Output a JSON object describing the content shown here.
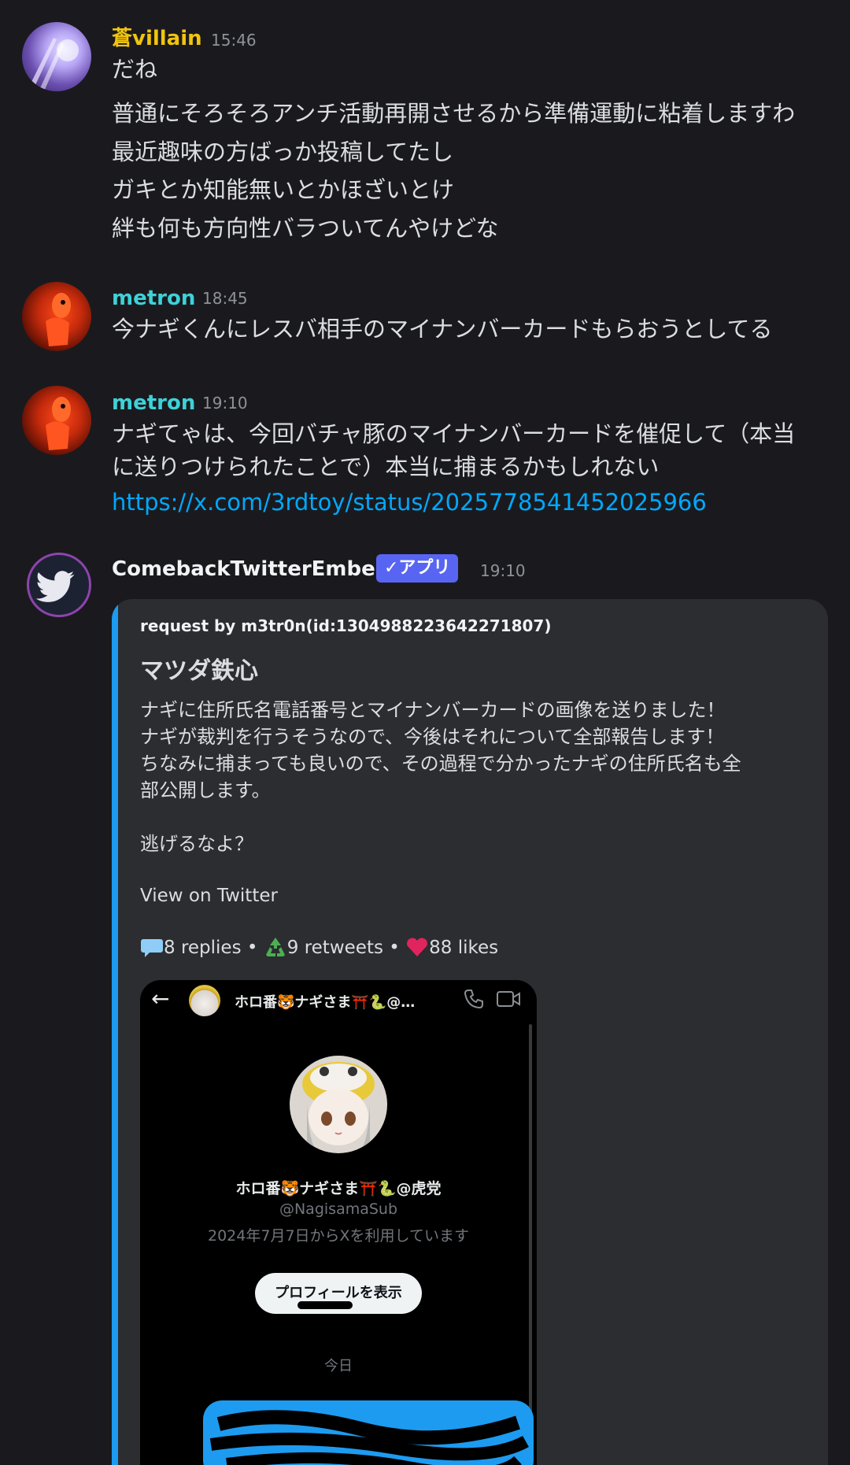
{
  "messages": [
    {
      "author": "蒼villain",
      "time": "15:46",
      "lines": [
        "だね",
        "普通にそろそろアンチ活動再開させるから準備運動に粘着しますわ",
        "最近趣味の方ばっか投稿してたし",
        "ガキとか知能無いとかほざいとけ",
        "絆も何も方向性バラついてんやけどな"
      ]
    },
    {
      "author": "metron",
      "time": "18:45",
      "lines": [
        "今ナギくんにレスバ相手のマイナンバーカードもらおうとしてる"
      ]
    },
    {
      "author": "metron",
      "time": "19:10",
      "lines": [
        "ナギてゃは、今回バチャ豚のマイナンバーカードを催促して（本当",
        "に送りつけられたことで）本当に捕まるかもしれない"
      ],
      "link": "https://x.com/3rdtoy/status/2025778541452025966"
    }
  ],
  "bot_message": {
    "author": "ComebackTwitterEmbed",
    "badge": "✓アプリ",
    "time": "19:10",
    "embed": {
      "request_line": "request by m3tr0n(id:1304988223642271807)",
      "title": "マツダ鉄心",
      "body_lines": [
        "ナギに住所氏名電話番号とマイナンバーカードの画像を送りました！",
        "ナギが裁判を行うそうなので、今後はそれについて全部報告します！",
        "ちなみに捕まっても良いので、その過程で分かったナギの住所氏名も全",
        "部公開します。",
        "",
        "逃げるなよ？"
      ],
      "view_link": "View on Twitter",
      "stats": {
        "replies": "8 replies",
        "retweets": "9 retweets",
        "likes": "88 likes",
        "separator": "•"
      },
      "screenshot": {
        "header_name": "ホロ番🐯ナギさま⛩️🐍@…",
        "profile_name": "ホロ番🐯ナギさま⛩️🐍@虎党",
        "handle": "@NagisamaSub",
        "joined": "2024年7月7日からXを利用しています",
        "view_profile_button": "プロフィールを表示",
        "date_divider": "今日"
      }
    }
  },
  "colors": {
    "background": "#1a1a1e",
    "villain_name": "#f1c40f",
    "metron_name": "#3ed1d8",
    "link": "#00a8fc",
    "badge": "#5865f2",
    "embed_bar": "#1d9bf0"
  }
}
